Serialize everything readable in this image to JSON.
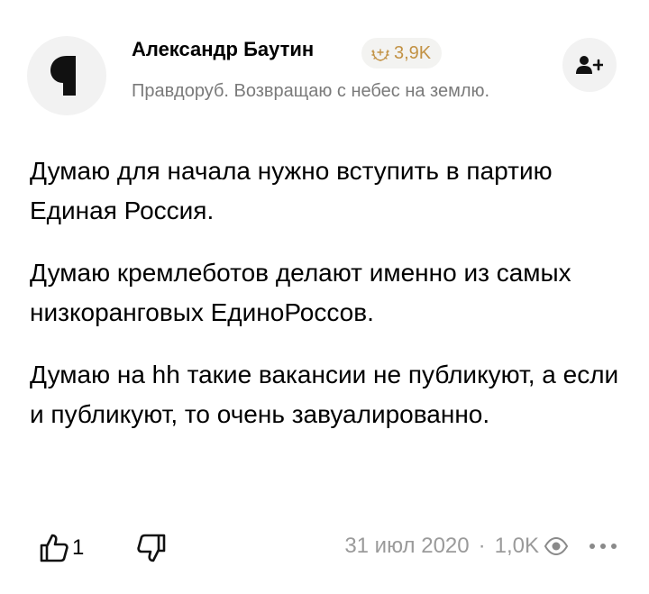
{
  "author": {
    "name": "Александр Баутин",
    "badge_count": "3,9K",
    "bio": "Правдоруб. Возвращаю с небес на землю."
  },
  "post": {
    "paragraphs": [
      "Думаю для начала нужно вступить в партию Единая Россия.",
      "Думаю кремлеботов делают именно из самых низкоранговых ЕдиноРоссов.",
      "Думаю на hh такие вакансии не публикуют, а если и публикуют, то очень завуалированно."
    ]
  },
  "footer": {
    "likes": "1",
    "date": "31 июл 2020",
    "separator": "·",
    "views": "1,0K"
  },
  "icons": {
    "avatar": "quote-glyph-icon",
    "badge": "laurel-icon",
    "subscribe": "add-user-icon",
    "like": "thumbs-up-icon",
    "dislike": "thumbs-down-icon",
    "views": "eye-icon",
    "more": "more-dots-icon"
  },
  "colors": {
    "badge_text": "#c29244",
    "muted_text": "#7a7a7a",
    "circle_bg": "#f2f2f2"
  }
}
